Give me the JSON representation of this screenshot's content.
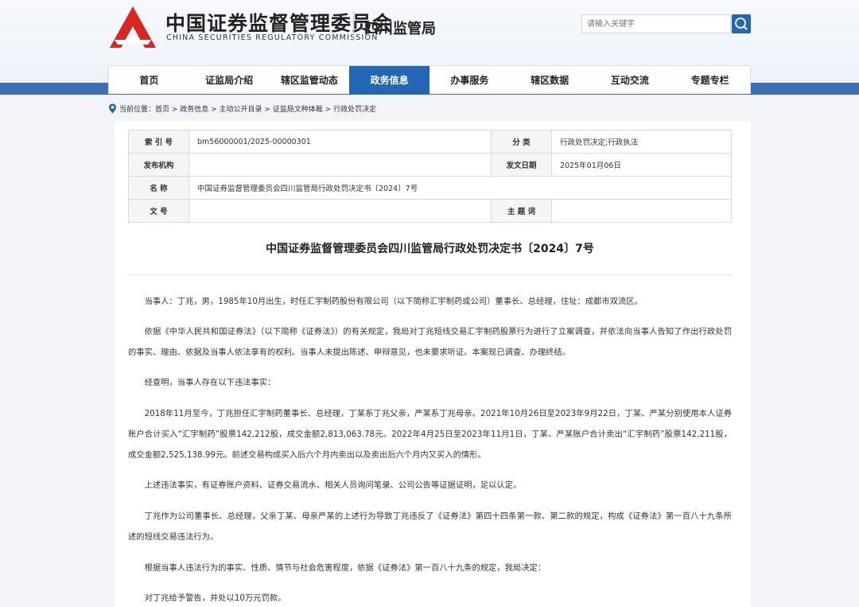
{
  "header": {
    "org_cn": "中国证券监督管理委员会",
    "org_en": "CHINA SECURITIES REGULATORY COMMISSION",
    "bureau": "四川监管局",
    "search_placeholder": "请输入关键字",
    "brand_red": "#d7281f",
    "brand_blue": "#2366b3"
  },
  "nav": {
    "items": [
      "首页",
      "证监局介绍",
      "辖区监管动态",
      "政务信息",
      "办事服务",
      "辖区数据",
      "互动交流",
      "专题专栏"
    ],
    "active_index": 3
  },
  "breadcrumb": {
    "label": "当前位置：",
    "path": "首页 > 政务信息 > 主动公开目录 > 证监局文种体裁 > 行政处罚决定"
  },
  "meta": {
    "index_label": "索 引 号",
    "index_value": "bm56000001/2025-00000301",
    "category_label": "分      类",
    "category_value": "行政处罚决定;行政执法",
    "issuer_label": "发布机构",
    "issuer_value": "",
    "date_label": "发文日期",
    "date_value": "2025年01月06日",
    "name_label": "名      称",
    "name_value": "中国证券监督管理委员会四川监管局行政处罚决定书〔2024〕7号",
    "docno_label": "文      号",
    "docno_value": "",
    "subject_label": "主 题 词",
    "subject_value": ""
  },
  "document": {
    "title": "中国证券监督管理委员会四川监管局行政处罚决定书〔2024〕7号",
    "paragraphs": [
      "当事人：丁兆，男，1985年10月出生，时任汇宇制药股份有限公司（以下简称汇宇制药或公司）董事长、总经理，住址：成都市双流区。",
      "依据《中华人民共和国证券法》（以下简称《证券法》）的有关规定，我局对丁兆短线交易汇宇制药股票行为进行了立案调查，并依法向当事人告知了作出行政处罚的事实、理由、依据及当事人依法享有的权利。当事人未提出陈述、申辩意见，也未要求听证。本案现已调查、办理终结。",
      "经查明，当事人存在以下违法事实：",
      "2018年11月至今，丁兆担任汇宇制药董事长、总经理，丁某系丁兆父亲，严某系丁兆母亲。2021年10月26日至2023年9月22日，丁某、严某分别使用本人证券账户合计买入“汇宇制药”股票142,212股，成交金额2,813,063.78元。2022年4月25日至2023年11月1日，丁某、严某账户合计卖出“汇宇制药”股票142,211股，成交金额2,525,138.99元。前述交易构成买入后六个月内卖出以及卖出后六个月内又买入的情形。",
      "上述违法事实，有证券账户资料、证券交易流水、相关人员询问笔录、公司公告等证据证明，足以认定。",
      "丁兆作为公司董事长、总经理，父亲丁某、母亲严某的上述行为导致丁兆违反了《证券法》第四十四条第一款、第二款的规定，构成《证券法》第一百八十九条所述的短线交易违法行为。",
      "根据当事人违法行为的事实、性质、情节与社会危害程度，依据《证券法》第一百八十九条的规定，我局决定：",
      "对丁兆给予警告，并处以10万元罚款。"
    ]
  }
}
